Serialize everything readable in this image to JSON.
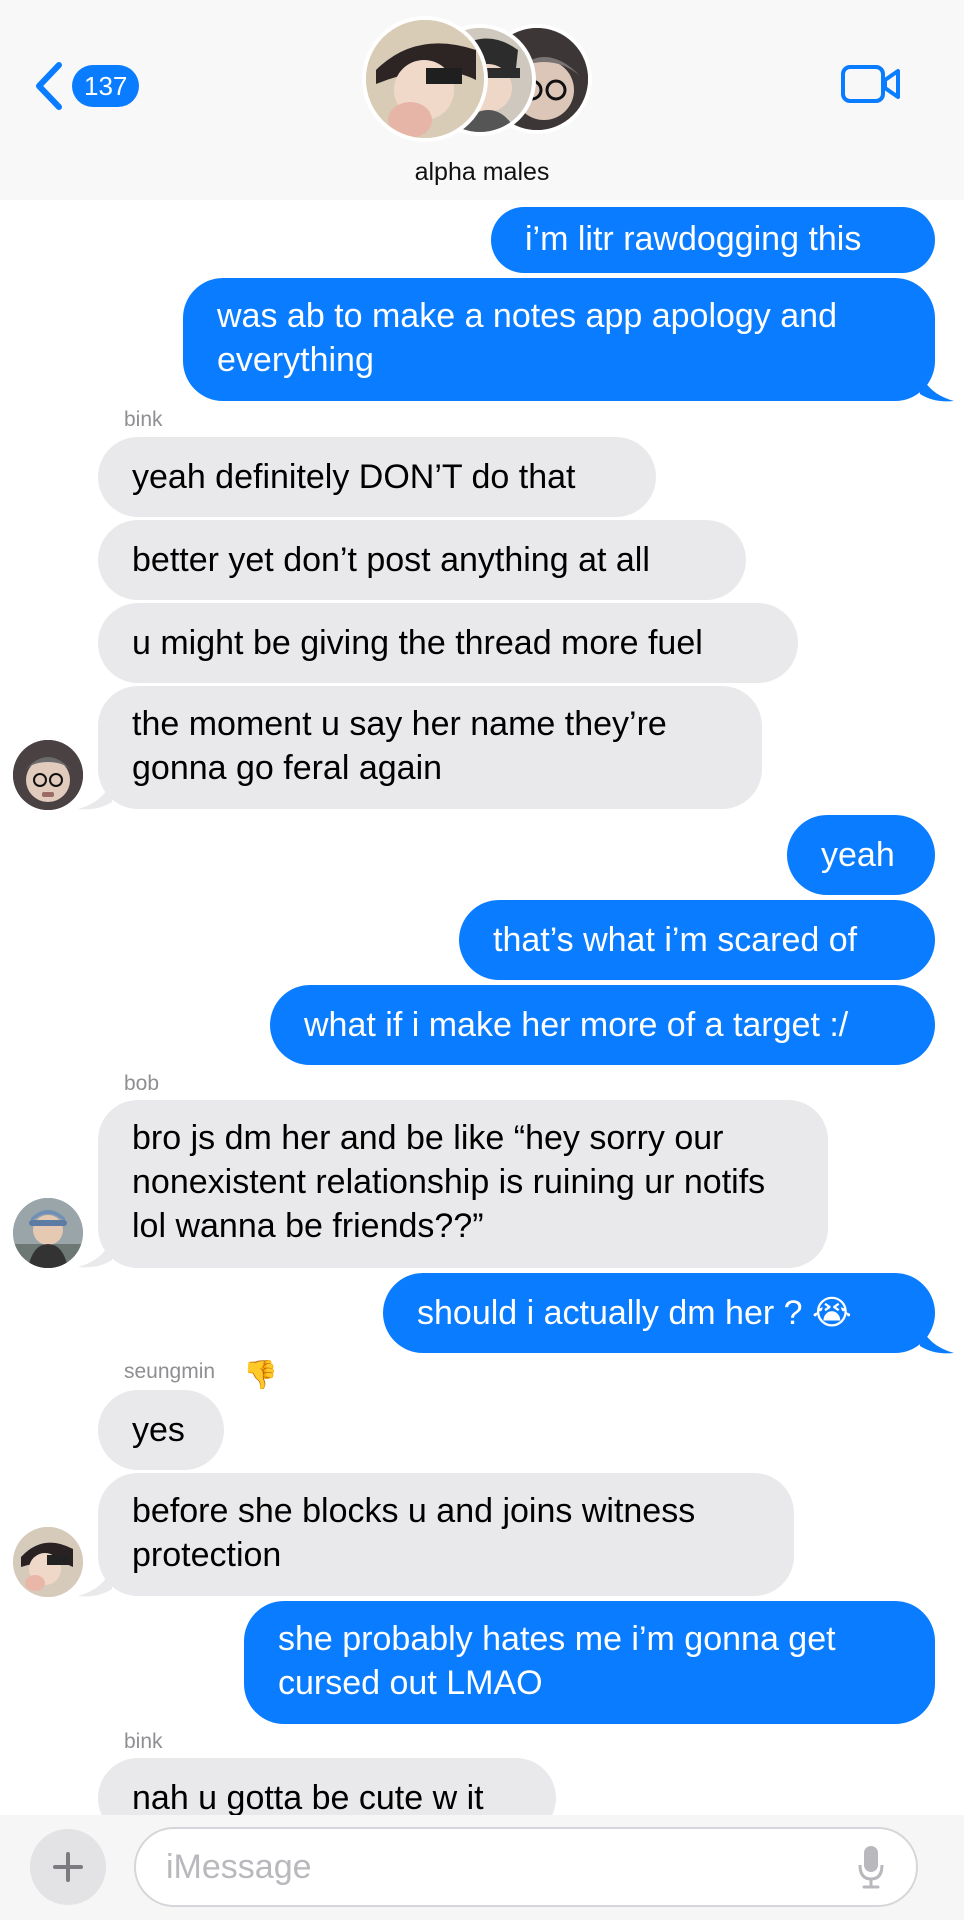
{
  "header": {
    "back_count": "137",
    "group_name": "alpha males"
  },
  "messages": [
    {
      "type": "out",
      "text": "i’m litr rawdogging this"
    },
    {
      "type": "out",
      "text": "was ab to make a notes app apology and everything"
    },
    {
      "type": "sender",
      "text": "bink"
    },
    {
      "type": "in",
      "text": "yeah definitely DON’T do that"
    },
    {
      "type": "in",
      "text": "better yet don’t post anything at all"
    },
    {
      "type": "in",
      "text": "u might be giving the thread more fuel"
    },
    {
      "type": "in",
      "text": "the moment u say her name they’re gonna go feral again"
    },
    {
      "type": "out",
      "text": "yeah"
    },
    {
      "type": "out",
      "text": "that’s what i’m scared of"
    },
    {
      "type": "out",
      "text": "what if i make her more of a target :/"
    },
    {
      "type": "sender",
      "text": "bob"
    },
    {
      "type": "in",
      "text": "bro js dm her and be like “hey sorry our nonexistent relationship is ruining ur notifs lol wanna be friends??”"
    },
    {
      "type": "out",
      "text": "should i actually dm her ? 😭"
    },
    {
      "type": "sender",
      "text": "seungmin",
      "emoji": "👎"
    },
    {
      "type": "in",
      "text": "yes"
    },
    {
      "type": "in",
      "text": "before she blocks u and joins witness protection"
    },
    {
      "type": "out",
      "text": "she probably hates me i’m gonna get cursed out LMAO"
    },
    {
      "type": "sender",
      "text": "bink"
    },
    {
      "type": "in",
      "text": "nah u gotta be cute w it"
    }
  ],
  "input": {
    "placeholder": "iMessage"
  },
  "colors": {
    "outgoing_bubble": "#0a7cff",
    "incoming_bubble": "#e9e9eb",
    "accent": "#0a7cff"
  },
  "icons": [
    "chevron-left-icon",
    "video-camera-icon",
    "plus-icon",
    "microphone-icon"
  ]
}
